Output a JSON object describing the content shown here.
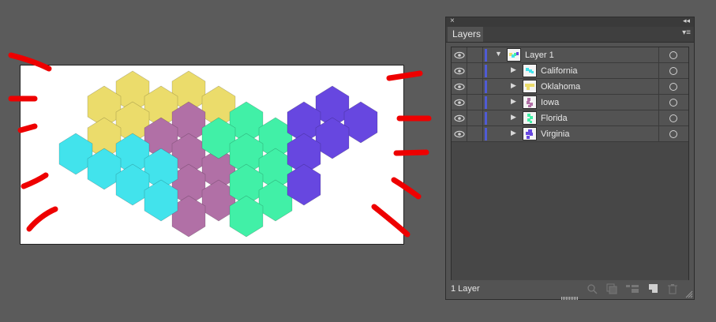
{
  "panel": {
    "close_glyph": "×",
    "collapse_glyph": "◂◂",
    "tab_label": "Layers",
    "menu_glyph": "▾≡",
    "layers": [
      {
        "name": "Layer 1",
        "expanded": true,
        "level": 0
      },
      {
        "name": "California",
        "expanded": false,
        "level": 1
      },
      {
        "name": "Oklahoma",
        "expanded": false,
        "level": 1
      },
      {
        "name": "Iowa",
        "expanded": false,
        "level": 1
      },
      {
        "name": "Florida",
        "expanded": false,
        "level": 1
      },
      {
        "name": "Virginia",
        "expanded": false,
        "level": 1
      }
    ],
    "footer_count": "1 Layer",
    "footer_icons": [
      "locate-object-icon",
      "make-clipping-mask-icon",
      "new-sublayer-icon",
      "new-layer-icon",
      "delete-icon"
    ]
  },
  "colors": {
    "yellow": "#ebdc6b",
    "cyan": "#42e3ec",
    "purple": "#b170a6",
    "green": "#41f0a7",
    "violet": "#6747e0",
    "annotation": "#ee0000",
    "layer_color": "#4f5bd5"
  }
}
